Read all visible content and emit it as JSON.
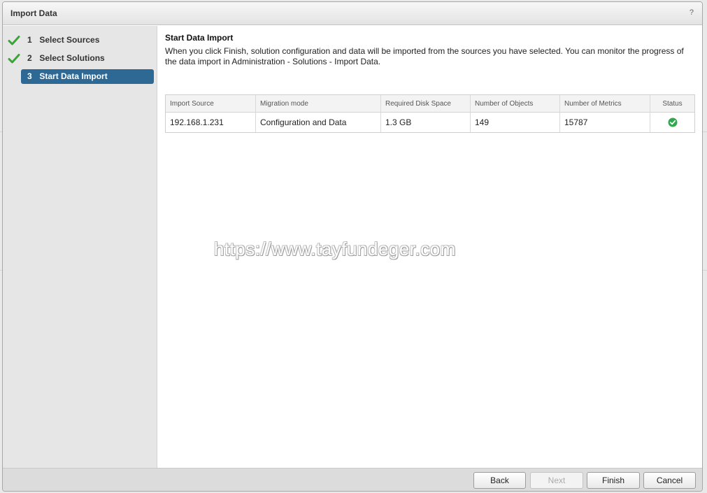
{
  "dialog": {
    "title": "Import Data",
    "help_label": "?"
  },
  "wizard": {
    "steps": [
      {
        "number": "1",
        "label": "Select Sources",
        "completed": true
      },
      {
        "number": "2",
        "label": "Select Solutions",
        "completed": true
      },
      {
        "number": "3",
        "label": "Start Data Import",
        "active": true
      }
    ]
  },
  "content": {
    "title": "Start Data Import",
    "description": "When you click Finish, solution configuration and data will be imported from the sources you have selected. You can monitor the progress of the data import in Administration - Solutions - Import Data."
  },
  "table": {
    "columns": [
      "Import Source",
      "Migration mode",
      "Required Disk Space",
      "Number of Objects",
      "Number of Metrics",
      "Status"
    ],
    "rows": [
      {
        "source": "192.168.1.231",
        "mode": "Configuration and Data",
        "disk": "1.3 GB",
        "objects": "149",
        "metrics": "15787",
        "status_icon": "check-circle-icon"
      }
    ]
  },
  "watermark": "https://www.tayfundeger.com",
  "footer": {
    "back_label": "Back",
    "next_label": "Next",
    "finish_label": "Finish",
    "cancel_label": "Cancel"
  },
  "colors": {
    "active_step": "#2e6996",
    "check_green": "#3aa33a",
    "status_green": "#2fa84f"
  }
}
